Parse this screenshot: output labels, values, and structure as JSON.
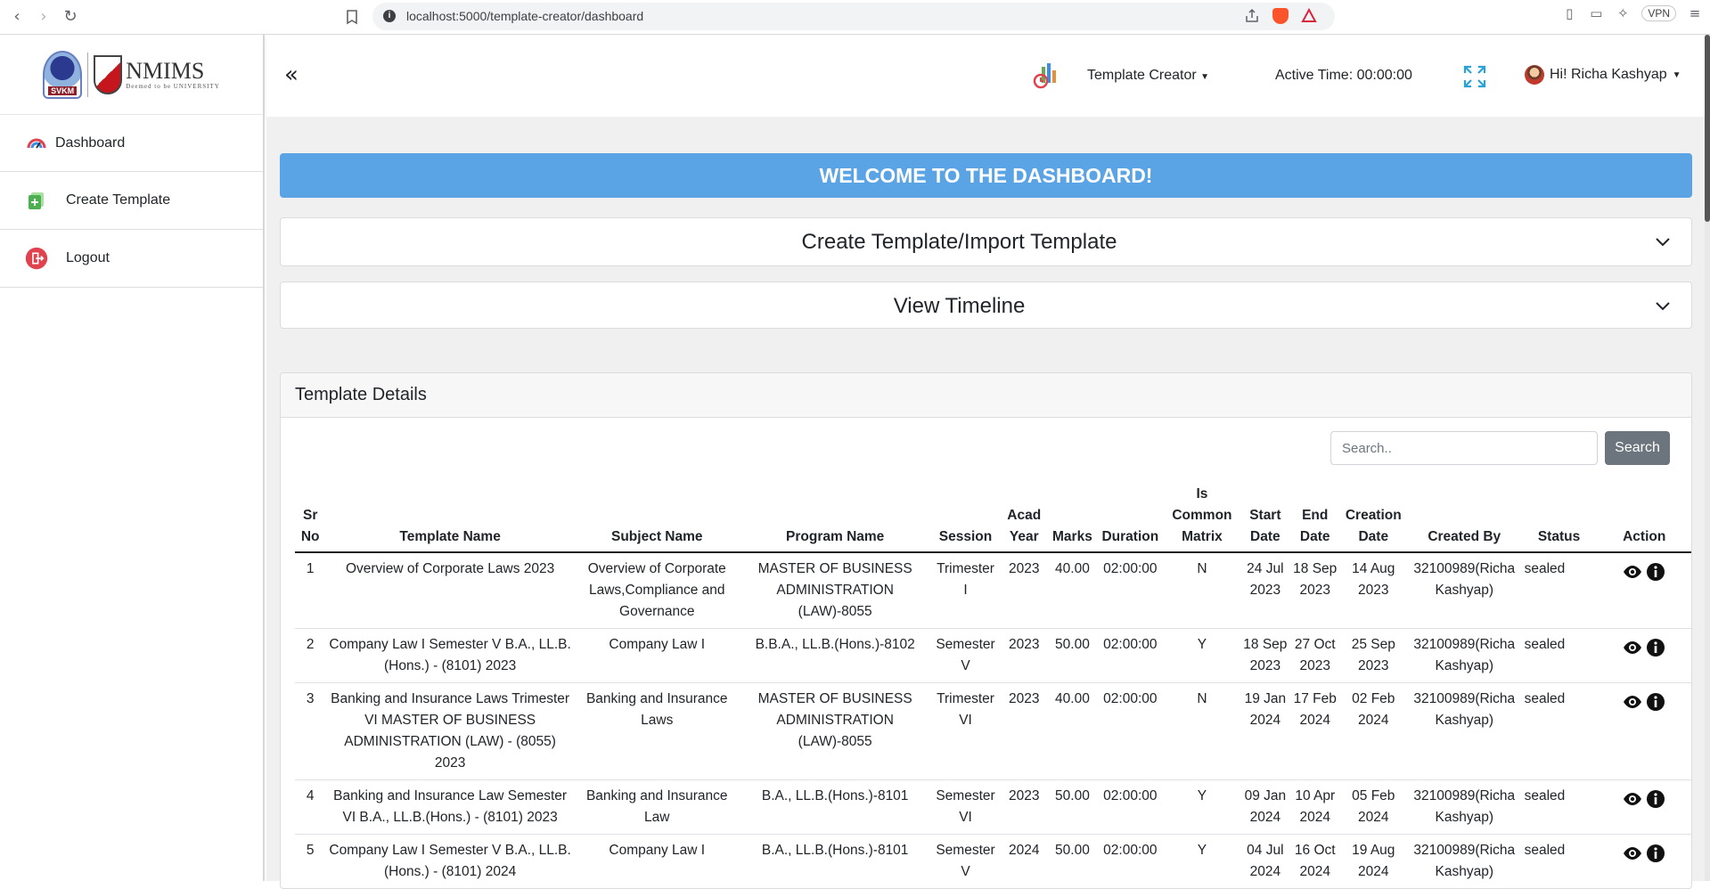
{
  "browser": {
    "url": "localhost:5000/template-creator/dashboard",
    "vpn_label": "VPN"
  },
  "sidebar": {
    "logo_left_text": "SVKM",
    "logo_right_text": "NMIMS",
    "logo_right_sub": "Deemed to be UNIVERSITY",
    "items": [
      {
        "label": "Dashboard",
        "icon": "gauge-icon"
      },
      {
        "label": "Create Template",
        "icon": "add-document-icon"
      },
      {
        "label": "Logout",
        "icon": "logout-icon"
      }
    ]
  },
  "header": {
    "collapse_glyph": "«",
    "module_dropdown": "Template Creator",
    "active_time": "Active Time: 00:00:00",
    "user_greeting": "Hi! Richa Kashyap"
  },
  "main": {
    "welcome": "WELCOME TO THE DASHBOARD!",
    "accordions": [
      {
        "title": "Create Template/Import Template"
      },
      {
        "title": "View Timeline"
      }
    ],
    "details": {
      "title": "Template Details",
      "search_placeholder": "Search..",
      "search_button": "Search",
      "columns": [
        "Sr No",
        "Template Name",
        "Subject Name",
        "Program Name",
        "Session",
        "Acad Year",
        "Marks",
        "Duration",
        "Is Common Matrix",
        "Start Date",
        "End Date",
        "Creation Date",
        "Created By",
        "Status",
        "Action"
      ],
      "rows": [
        {
          "sr": "1",
          "template": "Overview of Corporate Laws 2023",
          "subject": "Overview of Corporate Laws,Compliance and Governance",
          "program": "MASTER OF BUSINESS ADMINISTRATION (LAW)-8055",
          "session": "Trimester I",
          "year": "2023",
          "marks": "40.00",
          "duration": "02:00:00",
          "common": "N",
          "start": "24 Jul 2023",
          "end": "18 Sep 2023",
          "created": "14 Aug 2023",
          "by": "32100989(Richa Kashyap)",
          "status": "sealed"
        },
        {
          "sr": "2",
          "template": "Company Law I Semester V B.A., LL.B.(Hons.) - (8101) 2023",
          "subject": "Company Law I",
          "program": "B.B.A., LL.B.(Hons.)-8102",
          "session": "Semester V",
          "year": "2023",
          "marks": "50.00",
          "duration": "02:00:00",
          "common": "Y",
          "start": "18 Sep 2023",
          "end": "27 Oct 2023",
          "created": "25 Sep 2023",
          "by": "32100989(Richa Kashyap)",
          "status": "sealed"
        },
        {
          "sr": "3",
          "template": "Banking and Insurance Laws Trimester VI MASTER OF BUSINESS ADMINISTRATION (LAW) - (8055) 2023",
          "subject": "Banking and Insurance Laws",
          "program": "MASTER OF BUSINESS ADMINISTRATION (LAW)-8055",
          "session": "Trimester VI",
          "year": "2023",
          "marks": "40.00",
          "duration": "02:00:00",
          "common": "N",
          "start": "19 Jan 2024",
          "end": "17 Feb 2024",
          "created": "02 Feb 2024",
          "by": "32100989(Richa Kashyap)",
          "status": "sealed"
        },
        {
          "sr": "4",
          "template": "Banking and Insurance Law Semester VI B.A., LL.B.(Hons.) - (8101) 2023",
          "subject": "Banking and Insurance Law",
          "program": "B.A., LL.B.(Hons.)-8101",
          "session": "Semester VI",
          "year": "2023",
          "marks": "50.00",
          "duration": "02:00:00",
          "common": "Y",
          "start": "09 Jan 2024",
          "end": "10 Apr 2024",
          "created": "05 Feb 2024",
          "by": "32100989(Richa Kashyap)",
          "status": "sealed"
        },
        {
          "sr": "5",
          "template": "Company Law I Semester V B.A., LL.B.(Hons.) - (8101) 2024",
          "subject": "Company Law I",
          "program": "B.A., LL.B.(Hons.)-8101",
          "session": "Semester V",
          "year": "2024",
          "marks": "50.00",
          "duration": "02:00:00",
          "common": "Y",
          "start": "04 Jul 2024",
          "end": "16 Oct 2024",
          "created": "19 Aug 2024",
          "by": "32100989(Richa Kashyap)",
          "status": "sealed"
        }
      ]
    }
  },
  "colors": {
    "welcome_bg": "#5aa4e6",
    "search_btn": "#6c757d",
    "logout_icon": "#e0434d"
  }
}
